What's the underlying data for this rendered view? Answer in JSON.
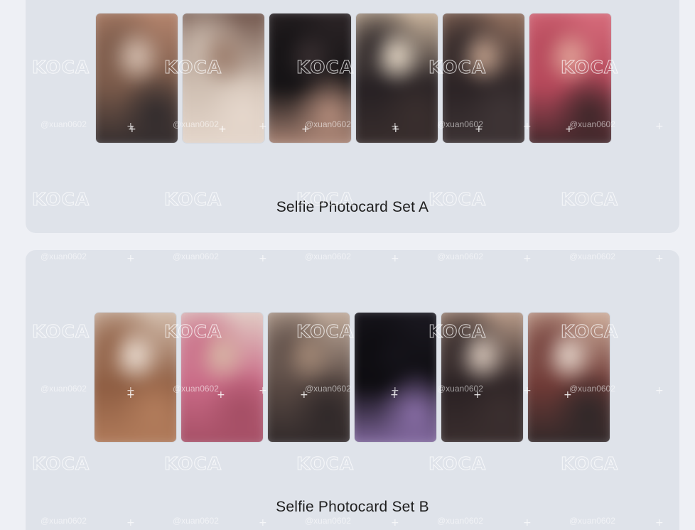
{
  "sets": [
    {
      "title": "Selfie Photocard Set A",
      "cards": [
        {
          "alt": "photocard-1",
          "colors": [
            "#7a5a4a",
            "#b98870",
            "#2f2a2c",
            "#d9c3b4"
          ]
        },
        {
          "alt": "photocard-2",
          "colors": [
            "#cfbfb2",
            "#6b4f45",
            "#e6d8cd",
            "#9a7a69"
          ]
        },
        {
          "alt": "photocard-3",
          "colors": [
            "#141214",
            "#2e2628",
            "#b58d7c",
            "#3a3032"
          ]
        },
        {
          "alt": "photocard-4",
          "colors": [
            "#262023",
            "#d8c1a8",
            "#3a2f2e",
            "#f0e2cf"
          ]
        },
        {
          "alt": "photocard-5",
          "colors": [
            "#2b2325",
            "#9d7966",
            "#3f3536",
            "#c9a792"
          ]
        },
        {
          "alt": "photocard-6",
          "colors": [
            "#b5485a",
            "#d96f7e",
            "#3a2628",
            "#e3a79b"
          ]
        }
      ]
    },
    {
      "title": "Selfie Photocard Set B",
      "cards": [
        {
          "alt": "photocard-7",
          "colors": [
            "#8e5d42",
            "#d9c6b6",
            "#b37d5c",
            "#efe3d8"
          ]
        },
        {
          "alt": "photocard-8",
          "colors": [
            "#c96a86",
            "#e3d3c9",
            "#a34d63",
            "#d8b9a6"
          ]
        },
        {
          "alt": "photocard-9",
          "colors": [
            "#5a4a44",
            "#cbb5a4",
            "#2e2728",
            "#a58a77"
          ]
        },
        {
          "alt": "photocard-10",
          "colors": [
            "#0d0c10",
            "#1c1a22",
            "#8a6fa8",
            "#15131a"
          ]
        },
        {
          "alt": "photocard-11",
          "colors": [
            "#2a2123",
            "#c4a591",
            "#3b2f2f",
            "#e0cfc2"
          ]
        },
        {
          "alt": "photocard-12",
          "colors": [
            "#6f3a36",
            "#d7b9a5",
            "#2d2728",
            "#eadbd0"
          ]
        }
      ]
    }
  ],
  "watermark": {
    "logo": "KOCA",
    "handle": "@xuan0602"
  }
}
